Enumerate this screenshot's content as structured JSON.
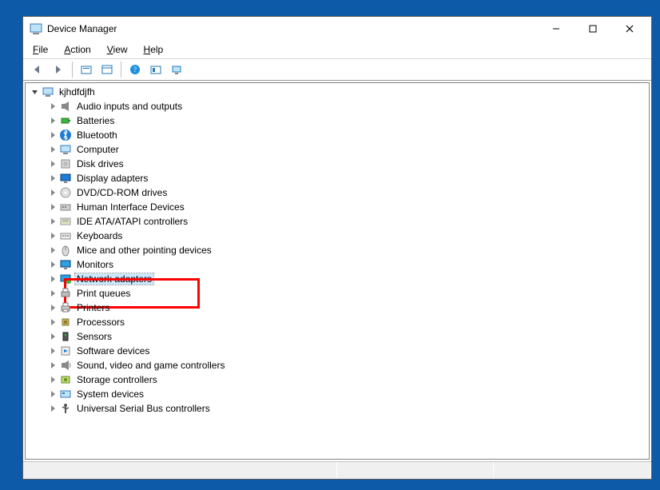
{
  "window": {
    "title": "Device Manager"
  },
  "menu": {
    "file": "File",
    "action": "Action",
    "view": "View",
    "help": "Help"
  },
  "toolbar_icons": [
    "back",
    "forward",
    "up-folder",
    "show-hidden",
    "properties",
    "help",
    "update-driver",
    "monitor"
  ],
  "root": {
    "name": "kjhdfdjfh",
    "expanded": true
  },
  "categories": [
    {
      "label": "Audio inputs and outputs",
      "icon": "speaker"
    },
    {
      "label": "Batteries",
      "icon": "battery"
    },
    {
      "label": "Bluetooth",
      "icon": "bluetooth"
    },
    {
      "label": "Computer",
      "icon": "computer"
    },
    {
      "label": "Disk drives",
      "icon": "disk"
    },
    {
      "label": "Display adapters",
      "icon": "display"
    },
    {
      "label": "DVD/CD-ROM drives",
      "icon": "dvd"
    },
    {
      "label": "Human Interface Devices",
      "icon": "hid"
    },
    {
      "label": "IDE ATA/ATAPI controllers",
      "icon": "ide"
    },
    {
      "label": "Keyboards",
      "icon": "keyboard"
    },
    {
      "label": "Mice and other pointing devices",
      "icon": "mouse"
    },
    {
      "label": "Monitors",
      "icon": "monitor"
    },
    {
      "label": "Network adapters",
      "icon": "network",
      "selected": true,
      "highlighted": true
    },
    {
      "label": "Print queues",
      "icon": "printqueue"
    },
    {
      "label": "Printers",
      "icon": "printer"
    },
    {
      "label": "Processors",
      "icon": "cpu"
    },
    {
      "label": "Sensors",
      "icon": "sensor"
    },
    {
      "label": "Software devices",
      "icon": "software"
    },
    {
      "label": "Sound, video and game controllers",
      "icon": "sound"
    },
    {
      "label": "Storage controllers",
      "icon": "storage"
    },
    {
      "label": "System devices",
      "icon": "system"
    },
    {
      "label": "Universal Serial Bus controllers",
      "icon": "usb"
    }
  ],
  "highlight_color": "#ff0000",
  "select_bg": "#cce8ff"
}
